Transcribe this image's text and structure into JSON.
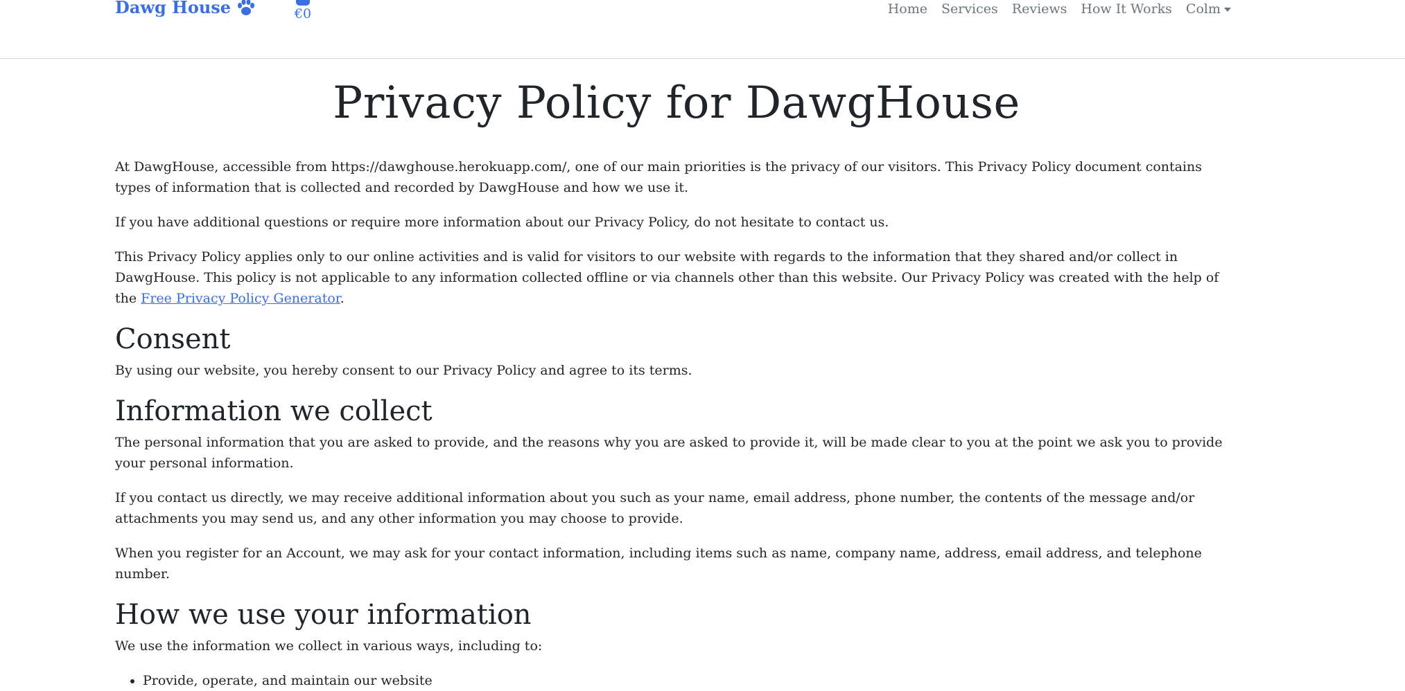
{
  "navbar": {
    "brand": "Dawg House",
    "brand_icon": "paw-icon",
    "cart_icon": "shopping-bag-icon",
    "cart_total": "€0",
    "links": [
      {
        "label": "Home"
      },
      {
        "label": "Services"
      },
      {
        "label": "Reviews"
      },
      {
        "label": "How It Works"
      },
      {
        "label": "Colm"
      }
    ]
  },
  "colors": {
    "brand": "#3b6fe0",
    "nav_text": "#6c757d",
    "body_text": "#212529"
  },
  "page": {
    "title": "Privacy Policy for DawgHouse",
    "intro_1": "At DawgHouse, accessible from https://dawghouse.herokuapp.com/, one of our main priorities is the privacy of our visitors. This Privacy Policy document contains types of information that is collected and recorded by DawgHouse and how we use it.",
    "intro_2": "If you have additional questions or require more information about our Privacy Policy, do not hesitate to contact us.",
    "intro_3": "This Privacy Policy applies only to our online activities and is valid for visitors to our website with regards to the information that they shared and/or collect in DawgHouse. This policy is not applicable to any information collected offline or via channels other than this website. Our Privacy Policy was created with the help of the ",
    "generator_link": "Free Privacy Policy Generator",
    "intro_3_end": ".",
    "consent_heading": "Consent",
    "consent_text": "By using our website, you hereby consent to our Privacy Policy and agree to its terms.",
    "collect_heading": "Information we collect",
    "collect_1": "The personal information that you are asked to provide, and the reasons why you are asked to provide it, will be made clear to you at the point we ask you to provide your personal information.",
    "collect_2": "If you contact us directly, we may receive additional information about you such as your name, email address, phone number, the contents of the message and/or attachments you may send us, and any other information you may choose to provide.",
    "collect_3": "When you register for an Account, we may ask for your contact information, including items such as name, company name, address, email address, and telephone number.",
    "use_heading": "How we use your information",
    "use_intro": "We use the information we collect in various ways, including to:",
    "use_items": [
      "Provide, operate, and maintain our website"
    ]
  }
}
